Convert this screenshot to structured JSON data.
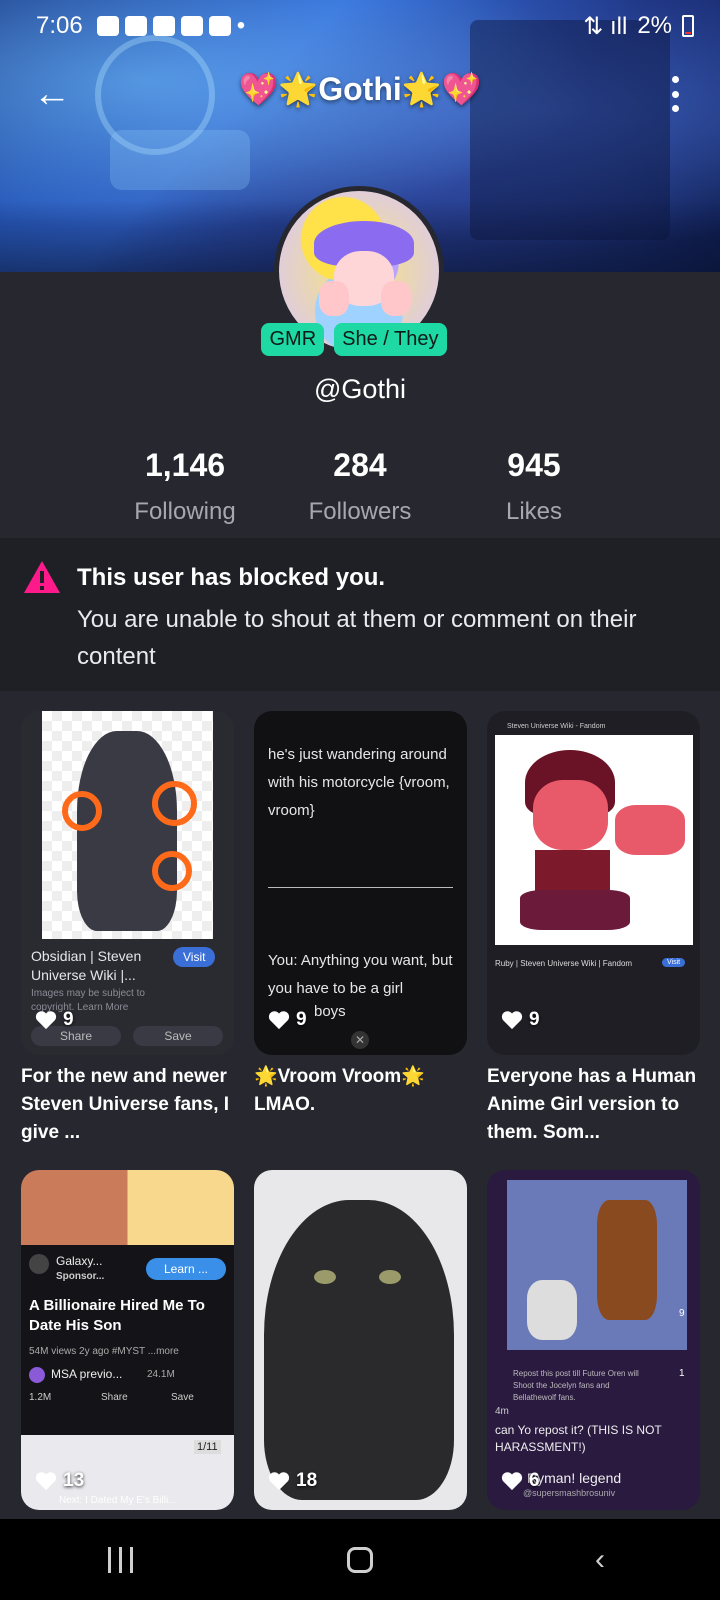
{
  "status_bar": {
    "time": "7:06",
    "battery": "2%"
  },
  "header": {
    "title_text": "Gothi",
    "title_prefix": "💖🌟",
    "title_suffix": "🌟💖"
  },
  "profile": {
    "badges": [
      "GMR",
      "She / They"
    ],
    "handle": "@Gothi",
    "stats": [
      {
        "value": "1,146",
        "label": "Following"
      },
      {
        "value": "284",
        "label": "Followers"
      },
      {
        "value": "945",
        "label": "Likes"
      }
    ]
  },
  "notice": {
    "title": "This user has blocked you.",
    "message": "You are unable to shout at them or comment on their content"
  },
  "posts": [
    {
      "likes": "9",
      "caption": "For the new and newer Steven Universe fans, I give ...",
      "inner_title": "Obsidian | Steven Universe Wiki |...",
      "visit": "Visit",
      "sub": "Images may be subject to copyright. Learn More",
      "share": "Share",
      "save": "Save"
    },
    {
      "likes": "9",
      "caption": "🌟Vroom Vroom🌟 LMAO.",
      "line1": "he's just wandering around with his motorcycle",
      "line2": "{vroom, vroom}",
      "line3": "You: Anything you want, but you have to be a girl",
      "line4": "boys"
    },
    {
      "likes": "9",
      "caption": "Everyone has a Human Anime Girl version to them. Som...",
      "top_label": "Steven Universe Wiki - Fandom",
      "inner_title": "Ruby | Steven Universe Wiki | Fandom",
      "visit": "Visit"
    },
    {
      "likes": "13",
      "caption": "",
      "ad_name": "Galaxy...",
      "ad_sub": "Sponsor...",
      "learn": "Learn ...",
      "video_title": "A Billionaire Hired Me To Date His Son",
      "meta": "54M views 2y ago #MYST ...more",
      "channel": "MSA previo...",
      "subs": "24.1M",
      "likes_count": "1.2M",
      "share": "Share",
      "save": "Save",
      "page": "1/11",
      "next": "Next: I Dated My E's Billi..."
    },
    {
      "likes": "18",
      "caption": ""
    },
    {
      "likes": "6",
      "caption": "",
      "repost": "Repost this post till Future Oren will Shoot the Jocelyn fans and Bellathewolf fans.",
      "question": "can Yo repost it? (THIS IS NOT HARASSMENT!)",
      "legend": "Ryman! legend",
      "user": "@supersmashbrosuniv",
      "side1": "9",
      "side2": "1",
      "time": "4m"
    }
  ],
  "colors": {
    "accent": "#1ed9a4",
    "warn": "#ff1a8c",
    "background": "#27272f"
  }
}
